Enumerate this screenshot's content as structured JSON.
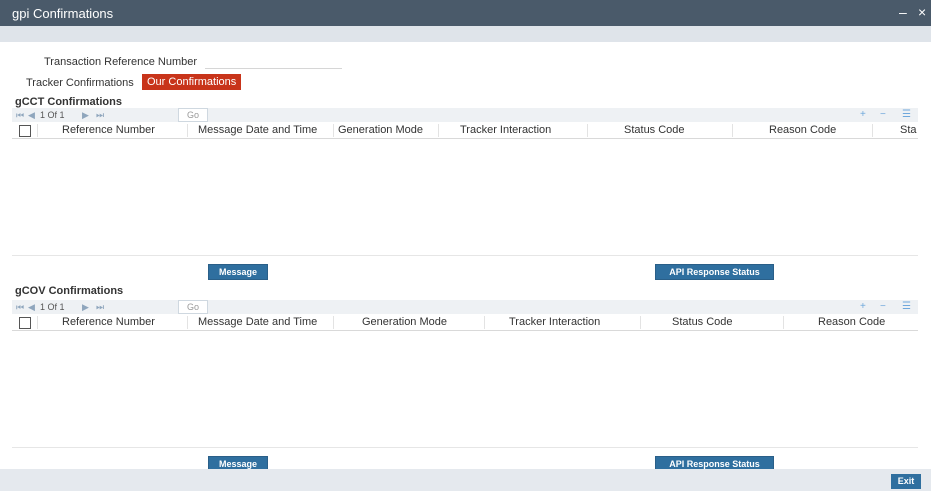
{
  "window": {
    "title": "gpi Confirmations",
    "minimize": "–",
    "close": "×"
  },
  "form": {
    "trn_label": "Transaction Reference Number",
    "trn_value": ""
  },
  "tabs": {
    "tracker": "Tracker Confirmations",
    "our": "Our Confirmations"
  },
  "gcct": {
    "title": "gCCT Confirmations",
    "pager": {
      "first": "⏮",
      "prev": "◀",
      "page_text": "1 Of 1",
      "next": "▶",
      "last": "⏭",
      "go": "Go"
    },
    "columns": [
      "Reference Number",
      "Message Date and Time",
      "Generation Mode",
      "Tracker Interaction",
      "Status Code",
      "Reason Code",
      "Sta"
    ],
    "buttons": {
      "message": "Message",
      "api": "API Response Status"
    }
  },
  "gcov": {
    "title": "gCOV Confirmations",
    "pager": {
      "first": "⏮",
      "prev": "◀",
      "page_text": "1 Of 1",
      "next": "▶",
      "last": "⏭",
      "go": "Go"
    },
    "columns": [
      "Reference Number",
      "Message Date and Time",
      "Generation Mode",
      "Tracker Interaction",
      "Status Code",
      "Reason Code"
    ],
    "buttons": {
      "message": "Message",
      "api": "API Response Status"
    }
  },
  "grid_tools": {
    "add": "+",
    "remove": "−",
    "settings": "☰"
  },
  "footer": {
    "exit": "Exit"
  }
}
